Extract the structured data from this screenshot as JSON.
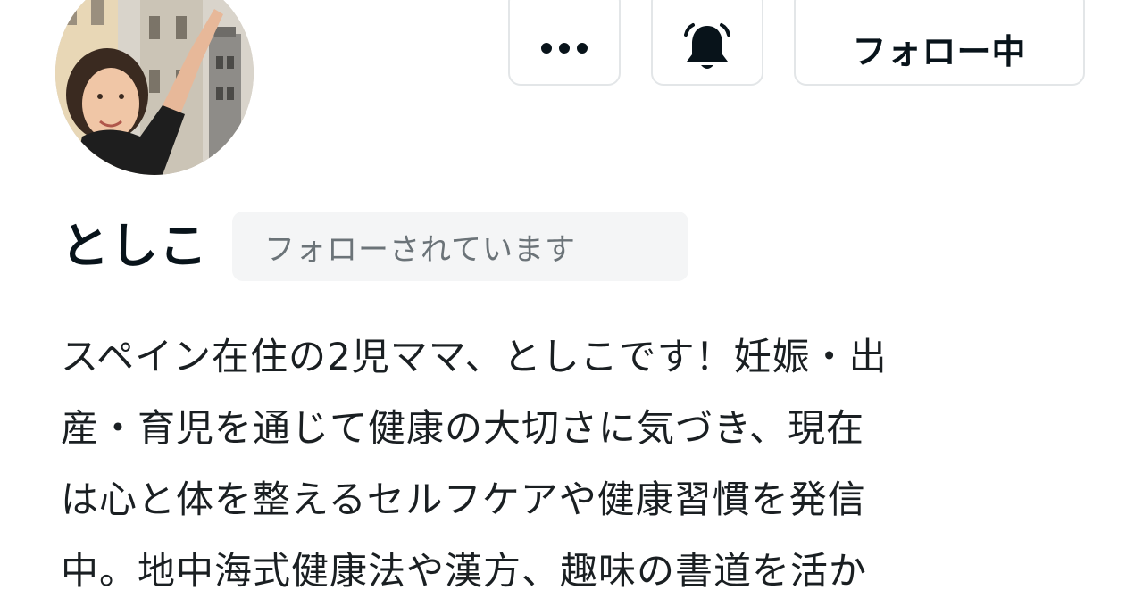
{
  "profile": {
    "name": "としこ",
    "follows_you_badge": "フォローされています",
    "avatar": "avatar-photo"
  },
  "actions": {
    "more_icon": "more-horizontal-icon",
    "bell_icon": "bell-icon",
    "follow_label": "フォロー中"
  },
  "bio": {
    "lines": [
      "スペイン在住の2児ママ、としこです！妊娠・出",
      "産・育児を通じて健康の大切さに気づき、現在",
      "は心と体を整えるセルフケアや健康習慣を発信",
      "中。地中海式健康法や漢方、趣味の書道を活か"
    ]
  },
  "colors": {
    "text": "#08131a",
    "badge_bg": "#f4f5f6",
    "badge_text": "#6b7378",
    "border": "#e3e6e8"
  }
}
